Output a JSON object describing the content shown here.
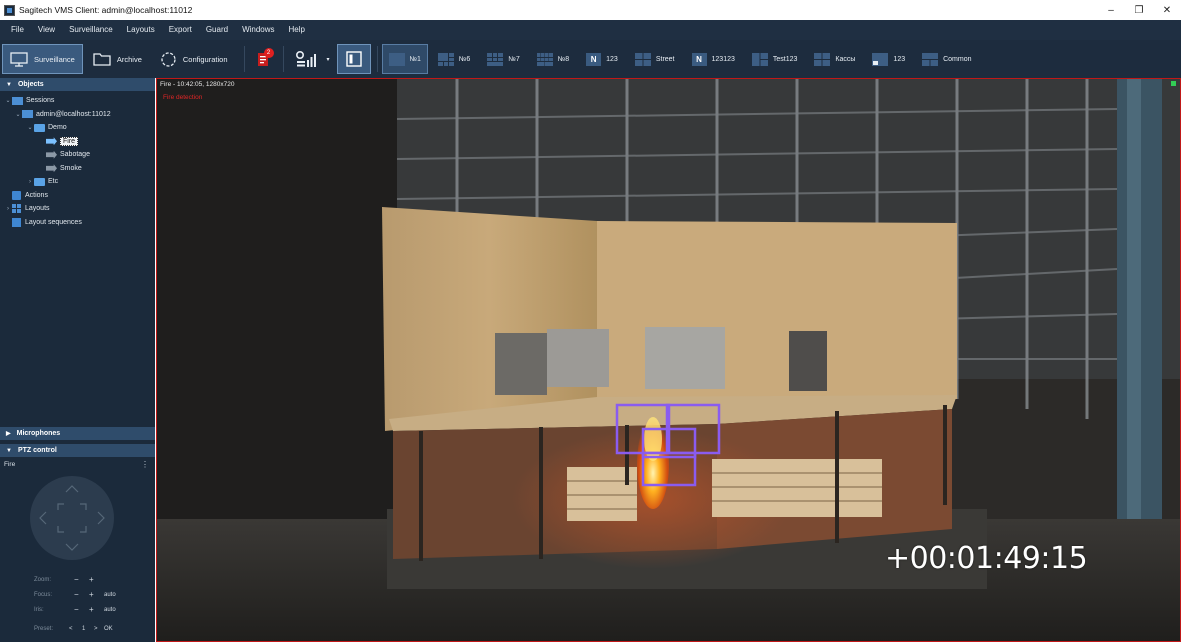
{
  "window": {
    "title": "Sagitech VMS Client: admin@localhost:11012",
    "controls": {
      "minimize": "–",
      "restore": "❐",
      "close": "✕"
    }
  },
  "menu": [
    "File",
    "View",
    "Surveillance",
    "Layouts",
    "Export",
    "Guard",
    "Windows",
    "Help"
  ],
  "toolbar": {
    "surveillance_label": "Surveillance",
    "archive_label": "Archive",
    "configuration_label": "Configuration",
    "alerts_count": "2",
    "layout_tabs": [
      {
        "label": "№1",
        "icon": "single-view-icon",
        "active": true
      },
      {
        "label": "№6",
        "icon": "grid-icon",
        "active": false
      },
      {
        "label": "№7",
        "icon": "grid-icon",
        "active": false
      },
      {
        "label": "№8",
        "icon": "grid-icon",
        "active": false
      },
      {
        "label": "123",
        "icon": "n-badge-icon",
        "active": false
      },
      {
        "label": "Street",
        "icon": "grid-icon",
        "active": false
      },
      {
        "label": "123123",
        "icon": "n-badge-icon",
        "active": false
      },
      {
        "label": "Test123",
        "icon": "grid-icon",
        "active": false
      },
      {
        "label": "Кассы",
        "icon": "grid-icon",
        "active": false
      },
      {
        "label": "123",
        "icon": "grid-icon",
        "active": false
      },
      {
        "label": "Common",
        "icon": "grid-icon",
        "active": false
      }
    ]
  },
  "objects_panel": {
    "title": "Objects",
    "tree": {
      "sessions": "Sessions",
      "server": "admin@localhost:11012",
      "demo_folder": "Demo",
      "cameras": [
        "Fire",
        "Sabotage",
        "Smoke"
      ],
      "selected_camera": "Fire",
      "etc_folder": "Etc",
      "actions": "Actions",
      "layouts": "Layouts",
      "layout_sequences": "Layout sequences"
    }
  },
  "microphones_panel": {
    "title": "Microphones"
  },
  "ptz_panel": {
    "title": "PTZ control",
    "camera": "Fire",
    "zoom_label": "Zoom:",
    "focus_label": "Focus:",
    "iris_label": "Iris:",
    "preset_label": "Preset:",
    "minus": "−",
    "plus": "+",
    "auto": "auto",
    "preset_prev": "<",
    "preset_value": "1",
    "preset_next": ">",
    "preset_ok": "OK"
  },
  "video": {
    "info": "Fire - 10:42:05, 1280x720",
    "alert_text": "Fire detection",
    "timecode": "+00:01:49:15"
  },
  "colors": {
    "menu_bg": "#1f2f42",
    "sidebar_bg": "#1b2a3b",
    "panel_header": "#2f4c6b",
    "accent": "#4c8fd4",
    "alert_red": "#e02020",
    "detection_box": "#8a5cf0"
  }
}
